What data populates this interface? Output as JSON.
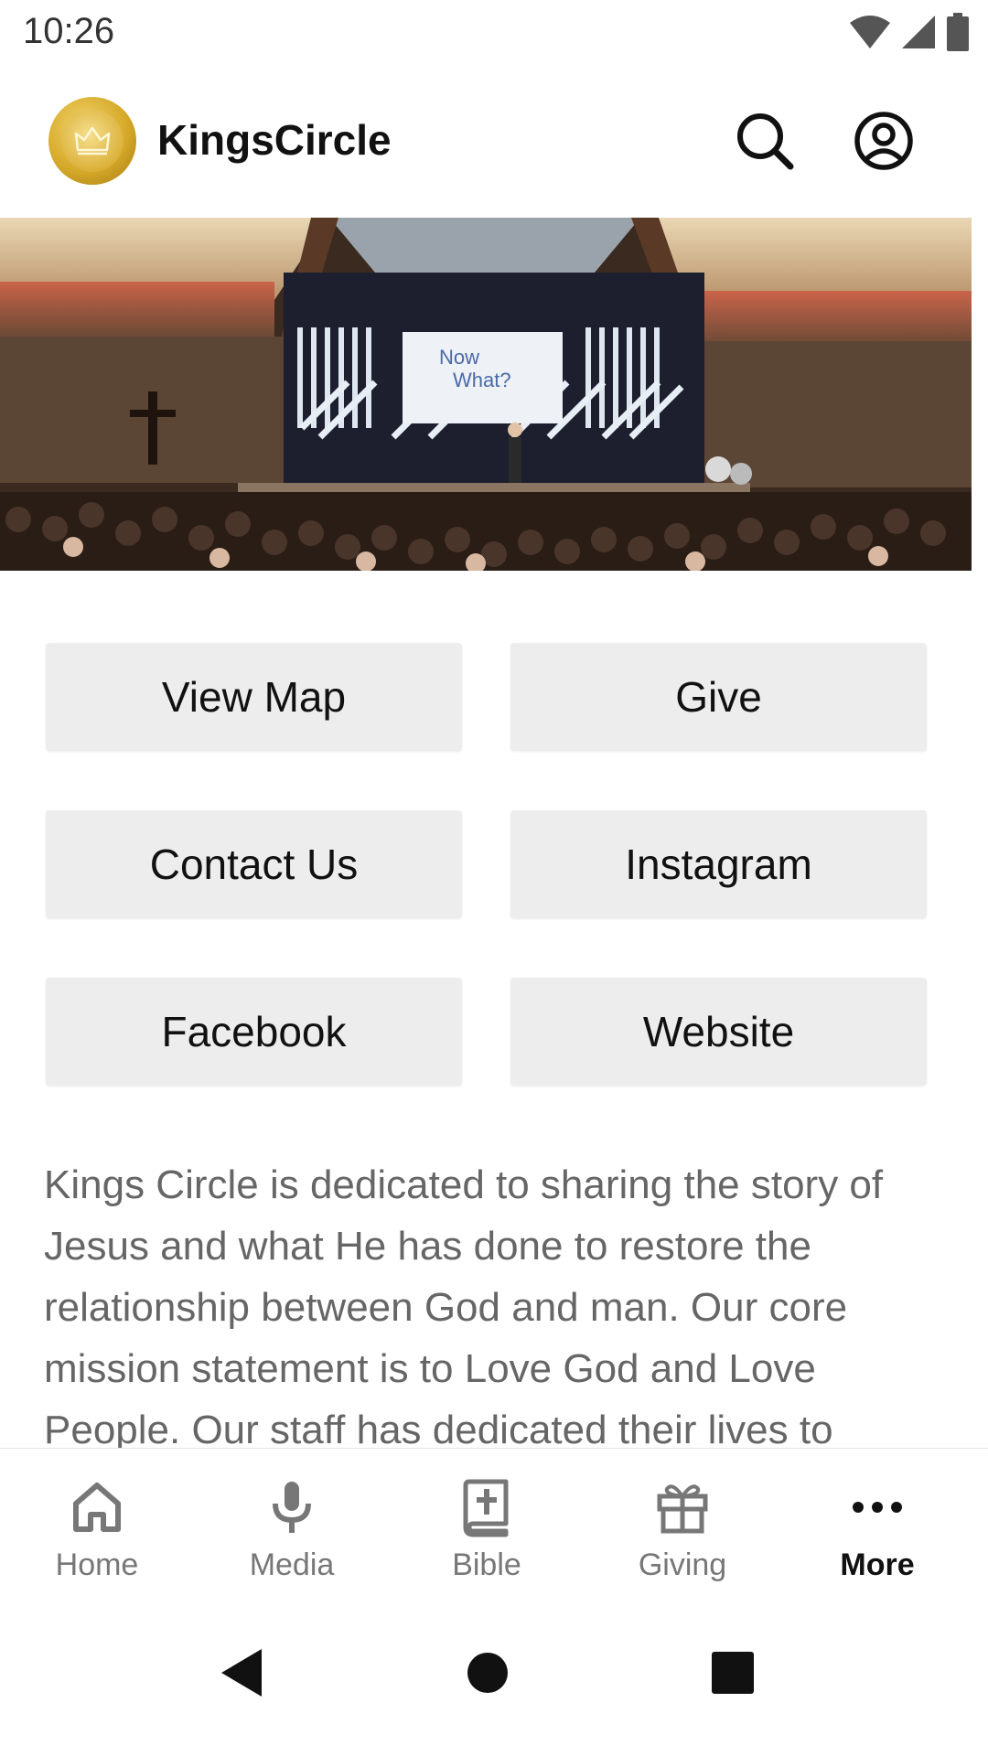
{
  "status_bar": {
    "time": "10:26"
  },
  "app_bar": {
    "title": "KingsCircle"
  },
  "hero": {
    "screen_line1": "Now",
    "screen_line2": "What?"
  },
  "buttons": [
    {
      "label": "View Map"
    },
    {
      "label": "Give"
    },
    {
      "label": "Contact Us"
    },
    {
      "label": "Instagram"
    },
    {
      "label": "Facebook"
    },
    {
      "label": "Website"
    }
  ],
  "description": "Kings Circle is dedicated to sharing the story of Jesus and what He has done to restore the relationship between God and man. Our core mission statement is to Love God and Love People. Our staff has dedicated their lives to",
  "tabs": [
    {
      "label": "Home",
      "icon": "home-icon",
      "active": false
    },
    {
      "label": "Media",
      "icon": "microphone-icon",
      "active": false
    },
    {
      "label": "Bible",
      "icon": "bible-icon",
      "active": false
    },
    {
      "label": "Giving",
      "icon": "gift-icon",
      "active": false
    },
    {
      "label": "More",
      "icon": "more-dots-icon",
      "active": true
    }
  ],
  "colors": {
    "button_bg": "#ededee",
    "active_tab": "#111111",
    "inactive_tab": "#777777",
    "logo_gold": "#d6aa2a"
  }
}
